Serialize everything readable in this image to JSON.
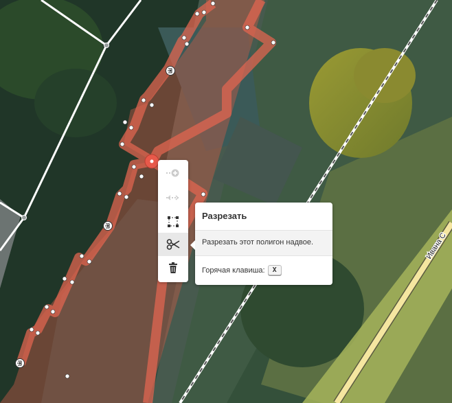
{
  "map": {
    "street_label": "Ивана С",
    "colors": {
      "selected_outline": "#e06650",
      "selected_fill": "#c65a48",
      "vertex_active": "#e8594a",
      "road_fill": "#f5e6a0",
      "road_verge": "#a6b45a",
      "footpath": "#ffffff",
      "railway": "#ffffff"
    }
  },
  "edit_menu": {
    "items": [
      {
        "name": "continue",
        "icon": "continue-icon",
        "enabled": false
      },
      {
        "name": "disconnect",
        "icon": "disconnect-icon",
        "enabled": false
      },
      {
        "name": "extract",
        "icon": "extract-icon",
        "enabled": true
      },
      {
        "name": "split",
        "icon": "scissors-icon",
        "enabled": true,
        "active": true
      },
      {
        "name": "delete",
        "icon": "trash-icon",
        "enabled": true
      }
    ]
  },
  "tooltip": {
    "heading": "Разрезать",
    "description": "Разрезать этот полигон надвое.",
    "hotkey_label": "Горячая клавиша:",
    "hotkey": "X"
  }
}
